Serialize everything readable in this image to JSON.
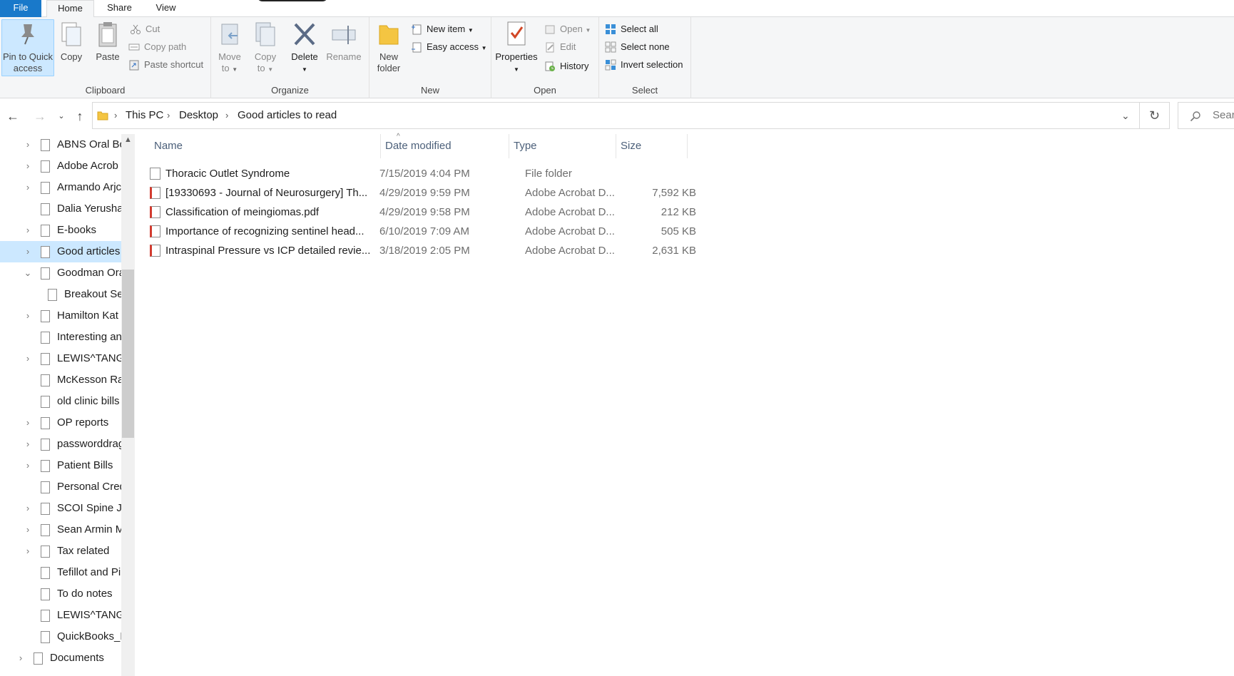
{
  "ribbon_tabs": [
    "File",
    "Home",
    "Share",
    "View"
  ],
  "clipboard": {
    "pin_label_line1": "Pin to Quick",
    "pin_label_line2": "access",
    "copy": "Copy",
    "paste": "Paste",
    "cut": "Cut",
    "copy_path": "Copy path",
    "paste_shortcut": "Paste shortcut",
    "group_label": "Clipboard"
  },
  "organize": {
    "move_to_line1": "Move",
    "move_to_line2": "to",
    "copy_to_line1": "Copy",
    "copy_to_line2": "to",
    "delete": "Delete",
    "rename": "Rename",
    "group_label": "Organize"
  },
  "new_group": {
    "new_folder_line1": "New",
    "new_folder_line2": "folder",
    "new_item": "New item",
    "easy_access": "Easy access",
    "group_label": "New"
  },
  "open_group": {
    "properties": "Properties",
    "open": "Open",
    "edit": "Edit",
    "history": "History",
    "group_label": "Open"
  },
  "select_group": {
    "select_all": "Select all",
    "select_none": "Select none",
    "invert_selection": "Invert selection",
    "group_label": "Select"
  },
  "breadcrumb": [
    "This PC",
    "Desktop",
    "Good articles to read"
  ],
  "search_placeholder": "Sear",
  "nav_items": [
    {
      "label": "ABNS Oral Bc",
      "expander": "right"
    },
    {
      "label": "Adobe Acrob",
      "expander": "right"
    },
    {
      "label": "Armando Arjc",
      "expander": "right"
    },
    {
      "label": "Dalia Yerusha",
      "expander": "none"
    },
    {
      "label": "E-books",
      "expander": "right"
    },
    {
      "label": "Good articles",
      "expander": "right",
      "selected": true
    },
    {
      "label": "Goodman Ora",
      "expander": "down"
    },
    {
      "label": "Breakout Se",
      "expander": "none",
      "child": true
    },
    {
      "label": "Hamilton Kat",
      "expander": "right"
    },
    {
      "label": "Interesting an",
      "expander": "none"
    },
    {
      "label": "LEWIS^TANG",
      "expander": "right"
    },
    {
      "label": "McKesson Ra",
      "expander": "none"
    },
    {
      "label": "old clinic bills",
      "expander": "none"
    },
    {
      "label": "OP reports",
      "expander": "right"
    },
    {
      "label": "passworddrag",
      "expander": "right"
    },
    {
      "label": "Patient Bills",
      "expander": "right"
    },
    {
      "label": "Personal Cred",
      "expander": "none"
    },
    {
      "label": "SCOI Spine Jc",
      "expander": "right"
    },
    {
      "label": "Sean Armin M",
      "expander": "right"
    },
    {
      "label": "Tax related",
      "expander": "right"
    },
    {
      "label": "Tefillot and Pi",
      "expander": "none"
    },
    {
      "label": "To do notes",
      "expander": "none"
    },
    {
      "label": "LEWIS^TANG",
      "expander": "none"
    },
    {
      "label": "QuickBooks_D",
      "expander": "none"
    },
    {
      "label": "Documents",
      "expander": "right",
      "parent": true
    }
  ],
  "columns": {
    "name": "Name",
    "date": "Date modified",
    "type": "Type",
    "size": "Size"
  },
  "files": [
    {
      "name": "Thoracic Outlet Syndrome",
      "date": "7/15/2019 4:04 PM",
      "type": "File folder",
      "size": "",
      "kind": "folder"
    },
    {
      "name": "[19330693 - Journal of Neurosurgery] Th...",
      "date": "4/29/2019 9:59 PM",
      "type": "Adobe Acrobat D...",
      "size": "7,592 KB",
      "kind": "pdf"
    },
    {
      "name": "Classification of meingiomas.pdf",
      "date": "4/29/2019 9:58 PM",
      "type": "Adobe Acrobat D...",
      "size": "212 KB",
      "kind": "pdf"
    },
    {
      "name": "Importance of recognizing sentinel head...",
      "date": "6/10/2019 7:09 AM",
      "type": "Adobe Acrobat D...",
      "size": "505 KB",
      "kind": "pdf"
    },
    {
      "name": "Intraspinal Pressure vs ICP detailed revie...",
      "date": "3/18/2019 2:05 PM",
      "type": "Adobe Acrobat D...",
      "size": "2,631 KB",
      "kind": "pdf"
    }
  ],
  "colors": {
    "accent": "#1979ca",
    "selection": "#cce8ff",
    "ribbon_bg": "#f5f6f7",
    "pdf_red": "#d23b2f"
  }
}
